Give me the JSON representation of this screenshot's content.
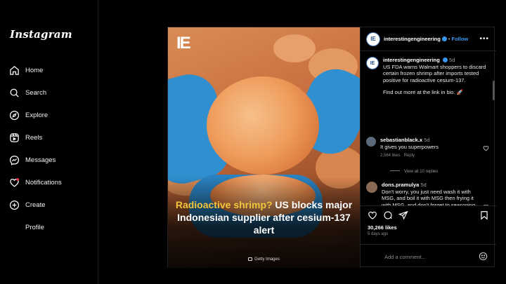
{
  "sidebar": {
    "logo": "Instagram",
    "items": [
      {
        "label": "Home",
        "icon": "home-icon"
      },
      {
        "label": "Search",
        "icon": "search-icon"
      },
      {
        "label": "Explore",
        "icon": "compass-icon"
      },
      {
        "label": "Reels",
        "icon": "reels-icon"
      },
      {
        "label": "Messages",
        "icon": "messenger-icon"
      },
      {
        "label": "Notifications",
        "icon": "heart-icon"
      },
      {
        "label": "Create",
        "icon": "plus-square-icon"
      },
      {
        "label": "Profile",
        "icon": "avatar-icon"
      }
    ]
  },
  "post": {
    "media": {
      "logo_text": "IE",
      "headline_highlight": "Radioactive shrimp?",
      "headline_rest": " US blocks major Indonesian supplier after cesium-137 alert",
      "credit": "Getty Images"
    },
    "header": {
      "avatar_text": "IE",
      "username": "interestingengineering",
      "separator": "•",
      "follow_label": "Follow",
      "more_label": "•••"
    },
    "caption": {
      "avatar_text": "IE",
      "username": "interestingengineering",
      "time": "5d",
      "text": "US FDA warns Walmart shoppers to discard certain frozen shrimp after imports tested positive for radioactive cesium-137.",
      "text2": "Find out more at the link in bio. 🚀"
    },
    "comments": [
      {
        "username": "sebastianblack.x",
        "time": "5d",
        "text": "It gives you superpowers",
        "likes": "2,564 likes",
        "reply_label": "Reply",
        "view_replies": "View all 10 replies"
      },
      {
        "username": "dons.pramulya",
        "time": "5d",
        "text": "Don't worry, you just need wash it with MSG, and boil it with MSG then frying it with MSG, and don't forget to seasoning it well and add some MSG."
      }
    ],
    "actions": {
      "likes": "30,266 likes",
      "ago": "5 days ago"
    },
    "add_comment": {
      "placeholder": "Add a comment..."
    }
  },
  "colors": {
    "accent": "#3897f0",
    "headline_highlight": "#f3c53a",
    "background": "#000000"
  }
}
